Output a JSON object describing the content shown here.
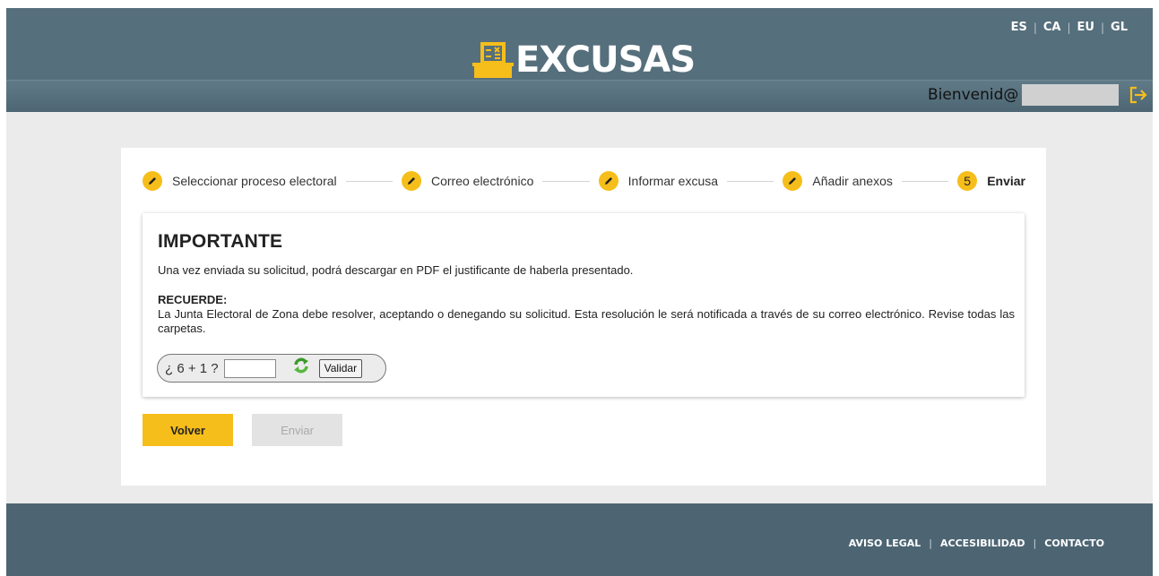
{
  "header": {
    "logo_text": "EXCUSAS",
    "languages": [
      "ES",
      "CA",
      "EU",
      "GL"
    ],
    "welcome": "Bienvenid@"
  },
  "steps": [
    {
      "label": "Seleccionar proceso electoral",
      "state": "done"
    },
    {
      "label": "Correo electrónico",
      "state": "done"
    },
    {
      "label": "Informar excusa",
      "state": "done"
    },
    {
      "label": "Añadir anexos",
      "state": "done"
    },
    {
      "label": "Enviar",
      "state": "active",
      "number": "5"
    }
  ],
  "info": {
    "title": "IMPORTANTE",
    "paragraph1": "Una vez enviada su solicitud, podrá descargar en PDF el justificante de haberla presentado.",
    "recuerde_label": "RECUERDE:",
    "paragraph2": "La Junta Electoral de Zona debe resolver, aceptando o denegando su solicitud. Esta resolución le será notificada a través de su correo electrónico. Revise todas las carpetas."
  },
  "captcha": {
    "question": "¿ 6 + 1 ?",
    "value": "",
    "validate_label": "Validar"
  },
  "buttons": {
    "back": "Volver",
    "send": "Enviar"
  },
  "footer": {
    "links": [
      "AVISO LEGAL",
      "ACCESIBILIDAD",
      "CONTACTO"
    ]
  },
  "colors": {
    "accent": "#f6be1a",
    "header": "#566f7c",
    "footer": "#4d6573"
  }
}
